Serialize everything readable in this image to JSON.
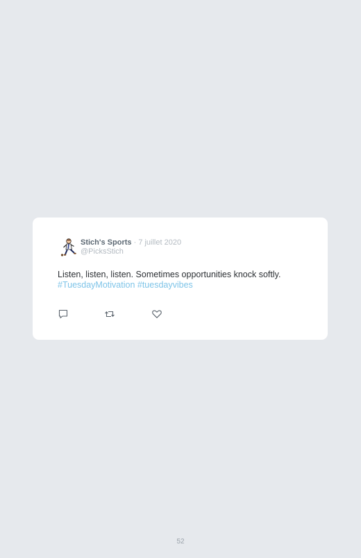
{
  "tweet": {
    "author_name": "Stich's Sports",
    "separator": " · ",
    "date": "7 juillet 2020",
    "handle": "@PicksStich",
    "text": "Listen, listen, listen. Sometimes opportunities knock softly.",
    "hashtags": "#TuesdayMotivation #tuesdayvibes",
    "avatar_icon": "cartoon-character-avatar",
    "actions": {
      "reply_icon": "reply-icon",
      "retweet_icon": "retweet-icon",
      "like_icon": "heart-icon"
    }
  },
  "colors": {
    "background": "#e6e9ed",
    "card": "#ffffff",
    "author": "#5b6772",
    "muted": "#b3bac1",
    "hashtag": "#7ec4e8",
    "text": "#2b2f33"
  },
  "page": {
    "number": "52"
  }
}
